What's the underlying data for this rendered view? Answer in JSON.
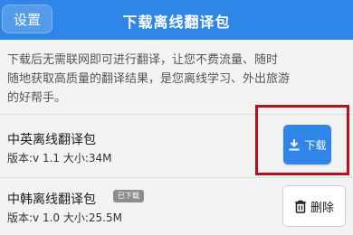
{
  "header": {
    "back_label": "设置",
    "title": "下载离线翻译包",
    "background": "#2f86e8"
  },
  "description": {
    "line1": "下载后无需联网即可进行翻译，让您不费流量、随时",
    "line2": "随地获取高质量的翻译结果，是您离线学习、外出旅游",
    "line3": "的好帮手。"
  },
  "packages": [
    {
      "title": "中英离线翻译包",
      "meta": "版本:v 1.1 大小:34M",
      "action_label": "下载",
      "action_icon": "download-icon"
    },
    {
      "title": "中韩离线翻译包",
      "badge": "已下载",
      "meta": "版本:v 1.0 大小:25.5M",
      "action_label": "删除",
      "action_icon": "trash-icon"
    }
  ],
  "colors": {
    "accent": "#2f86e8",
    "highlight": "#b5121b"
  }
}
